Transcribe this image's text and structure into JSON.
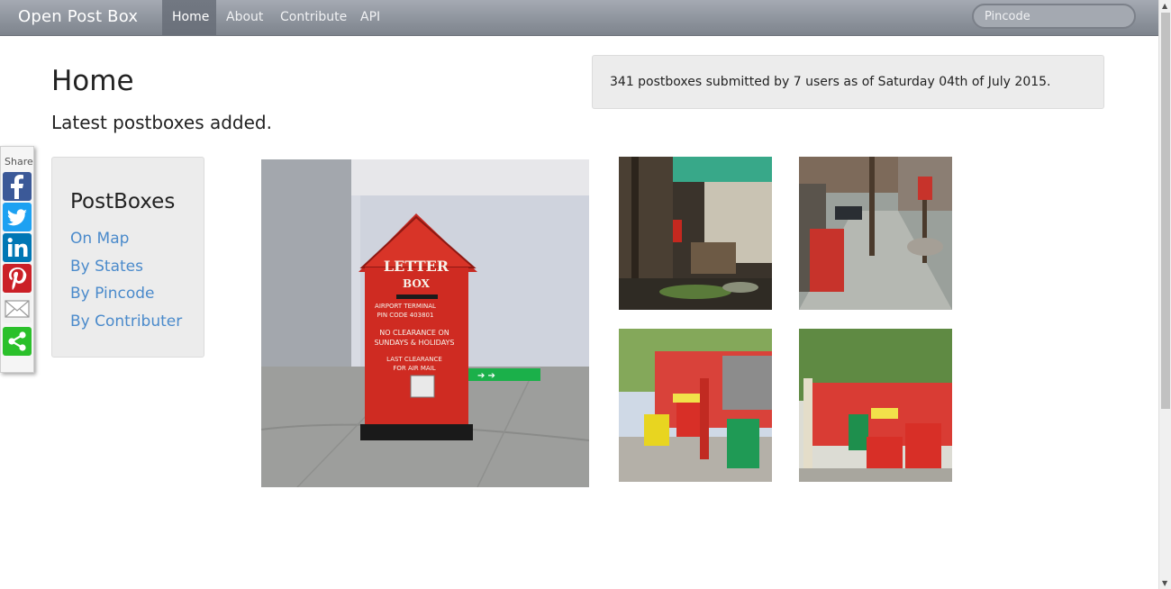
{
  "nav": {
    "brand": "Open Post Box",
    "items": [
      {
        "label": "Home",
        "active": true
      },
      {
        "label": "About"
      },
      {
        "label": "Contribute"
      },
      {
        "label": "API"
      }
    ],
    "search_placeholder": "Pincode"
  },
  "main": {
    "title": "Home",
    "subtitle": "Latest postboxes added.",
    "stats": "341 postboxes submitted by 7 users as of Saturday 04th of July 2015."
  },
  "sidebar": {
    "title": "PostBoxes",
    "links": [
      "On Map",
      "By States",
      "By Pincode",
      "By Contributer"
    ]
  },
  "share": {
    "label": "Share",
    "buttons": [
      "facebook-icon",
      "twitter-icon",
      "linkedin-icon",
      "pinterest-icon",
      "email-icon",
      "share-icon"
    ]
  },
  "photos": {
    "featured": {
      "sign_title": "LETTER",
      "sign_sub": "BOX",
      "sign_lines": [
        "AIRPORT TERMINAL",
        "PIN CODE 403801",
        "NO CLEARANCE ON",
        "SUNDAYS & HOLIDAYS",
        "LAST CLEARANCE",
        "FOR AIR MAIL"
      ]
    }
  },
  "colors": {
    "link": "#4a8acb",
    "facebook": "#3b5998",
    "twitter": "#1da1f2",
    "linkedin": "#0077b5",
    "pinterest": "#cb2027",
    "share": "#2bc02b"
  }
}
